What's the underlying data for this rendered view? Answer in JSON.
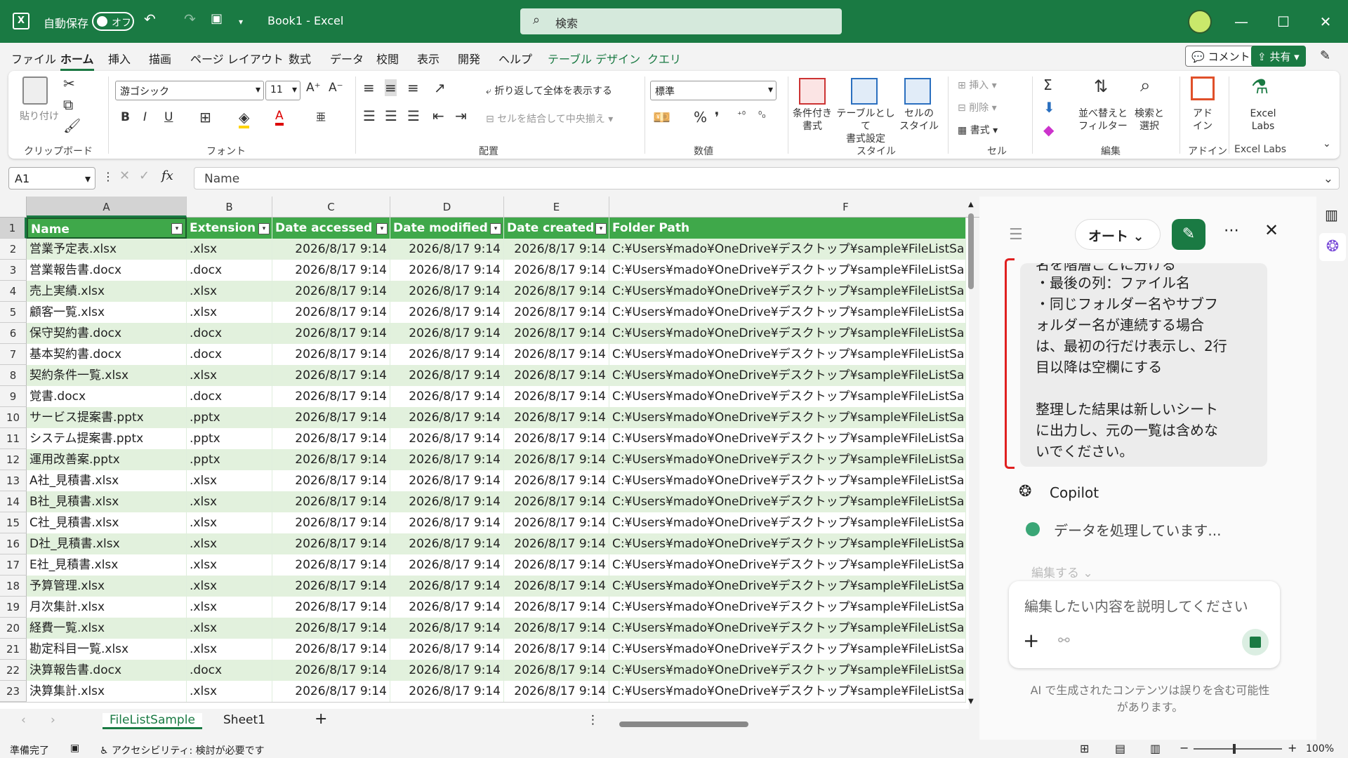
{
  "titlebar": {
    "autosave_label": "自動保存",
    "autosave_state": "オフ",
    "doc_title": "Book1  -  Excel",
    "search_placeholder": "検索"
  },
  "ribbon_tabs": [
    "ファイル",
    "ホーム",
    "挿入",
    "描画",
    "ページ レイアウト",
    "数式",
    "データ",
    "校閲",
    "表示",
    "開発",
    "ヘルプ",
    "テーブル デザイン",
    "クエリ"
  ],
  "header_buttons": {
    "comment": "コメント",
    "share": "共有"
  },
  "ribbon": {
    "clipboard": {
      "paste": "貼り付け",
      "label": "クリップボード"
    },
    "font": {
      "name": "游ゴシック",
      "size": "11",
      "label": "フォント"
    },
    "alignment": {
      "wrap": "折り返して全体を表示する",
      "merge": "セルを結合して中央揃え",
      "label": "配置"
    },
    "number": {
      "format": "標準",
      "label": "数値"
    },
    "styles": {
      "conditional": "条件付き\n書式",
      "table": "テーブルとして\n書式設定",
      "cell": "セルの\nスタイル",
      "label": "スタイル"
    },
    "cells": {
      "insert": "挿入",
      "delete": "削除",
      "format": "書式",
      "label": "セル"
    },
    "editing": {
      "sort": "並べ替えと\nフィルター",
      "find": "検索と\n選択",
      "label": "編集"
    },
    "addins": {
      "addin": "アド\nイン",
      "label": "アドイン"
    },
    "labs": {
      "name": "Excel\nLabs",
      "label": "Excel Labs"
    }
  },
  "formula_bar": {
    "name_box": "A1",
    "fx": "fx",
    "content": "Name"
  },
  "grid": {
    "columns": [
      "A",
      "B",
      "C",
      "D",
      "E",
      "F"
    ],
    "header": [
      "Name",
      "Extension",
      "Date accessed",
      "Date modified",
      "Date created",
      "Folder Path"
    ],
    "date_value": "2026/8/17 9:14",
    "folder_value": "C:¥Users¥mado¥OneDrive¥デスクトップ¥sample¥FileListSa",
    "rows": [
      [
        "2",
        "営業予定表.xlsx",
        ".xlsx"
      ],
      [
        "3",
        "営業報告書.docx",
        ".docx"
      ],
      [
        "4",
        "売上実績.xlsx",
        ".xlsx"
      ],
      [
        "5",
        "顧客一覧.xlsx",
        ".xlsx"
      ],
      [
        "6",
        "保守契約書.docx",
        ".docx"
      ],
      [
        "7",
        "基本契約書.docx",
        ".docx"
      ],
      [
        "8",
        "契約条件一覧.xlsx",
        ".xlsx"
      ],
      [
        "9",
        "覚書.docx",
        ".docx"
      ],
      [
        "10",
        "サービス提案書.pptx",
        ".pptx"
      ],
      [
        "11",
        "システム提案書.pptx",
        ".pptx"
      ],
      [
        "12",
        "運用改善案.pptx",
        ".pptx"
      ],
      [
        "13",
        "A社_見積書.xlsx",
        ".xlsx"
      ],
      [
        "14",
        "B社_見積書.xlsx",
        ".xlsx"
      ],
      [
        "15",
        "C社_見積書.xlsx",
        ".xlsx"
      ],
      [
        "16",
        "D社_見積書.xlsx",
        ".xlsx"
      ],
      [
        "17",
        "E社_見積書.xlsx",
        ".xlsx"
      ],
      [
        "18",
        "予算管理.xlsx",
        ".xlsx"
      ],
      [
        "19",
        "月次集計.xlsx",
        ".xlsx"
      ],
      [
        "20",
        "経費一覧.xlsx",
        ".xlsx"
      ],
      [
        "21",
        "勘定科目一覧.xlsx",
        ".xlsx"
      ],
      [
        "22",
        "決算報告書.docx",
        ".docx"
      ],
      [
        "23",
        "決算集計.xlsx",
        ".xlsx"
      ]
    ]
  },
  "sheets": [
    "FileListSample",
    "Sheet1"
  ],
  "status": {
    "ready": "準備完了",
    "accessibility": "アクセシビリティ: 検討が必要です",
    "zoom": "100%"
  },
  "copilot": {
    "mode": "オート",
    "message_lines": [
      "名を階層ごとに分ける",
      "・最後の列：ファイル名",
      "・同じフォルダー名やサブフ",
      "ォルダー名が連続する場合",
      "は、最初の行だけ表示し、2行",
      "目以降は空欄にする",
      "",
      "整理した結果は新しいシート",
      "に出力し、元の一覧は含めな",
      "いでください。"
    ],
    "name": "Copilot",
    "processing": "データを処理しています...",
    "edit_label": "編集する",
    "input_placeholder": "編集したい内容を説明してください",
    "disclaimer_1": "AI で生成されたコンテンツは誤りを含む可能性",
    "disclaimer_2": "があります。"
  }
}
